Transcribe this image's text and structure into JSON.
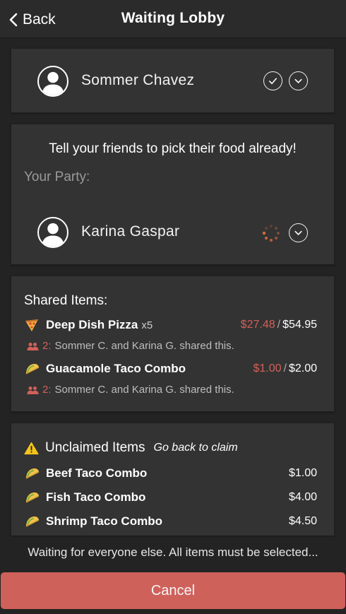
{
  "header": {
    "back_label": "Back",
    "title": "Waiting Lobby"
  },
  "host": {
    "name": "Sommer Chavez"
  },
  "party": {
    "prompt": "Tell your friends to pick their food already!",
    "label": "Your Party:",
    "members": [
      {
        "name": "Karina Gaspar",
        "status": "loading"
      }
    ]
  },
  "shared": {
    "title": "Shared Items:",
    "items": [
      {
        "icon": "pizza-icon",
        "name": "Deep Dish Pizza",
        "qty": "x5",
        "my_price": "$27.48",
        "separator": "/",
        "total_price": "$54.95",
        "share_count": "2:",
        "share_text": "Sommer C. and Karina G. shared this."
      },
      {
        "icon": "taco-icon",
        "name": "Guacamole Taco Combo",
        "qty": "",
        "my_price": "$1.00",
        "separator": "/",
        "total_price": "$2.00",
        "share_count": "2:",
        "share_text": "Sommer C. and Karina G. shared this."
      }
    ]
  },
  "unclaimed": {
    "title": "Unclaimed Items",
    "hint": "Go back to claim",
    "items": [
      {
        "icon": "taco-icon",
        "name": "Beef Taco Combo",
        "price": "$1.00"
      },
      {
        "icon": "taco-icon",
        "name": "Fish Taco Combo",
        "price": "$4.00"
      },
      {
        "icon": "taco-icon",
        "name": "Shrimp Taco Combo",
        "price": "$4.50"
      }
    ]
  },
  "status_text": "Waiting for everyone else. All items must be selected...",
  "cancel_label": "Cancel",
  "colors": {
    "background": "#232323",
    "card": "#333333",
    "accent_red": "#cf615b",
    "price_red": "#d26159",
    "warning_yellow": "#f5c518",
    "spinner_orange": "#e0703a"
  }
}
